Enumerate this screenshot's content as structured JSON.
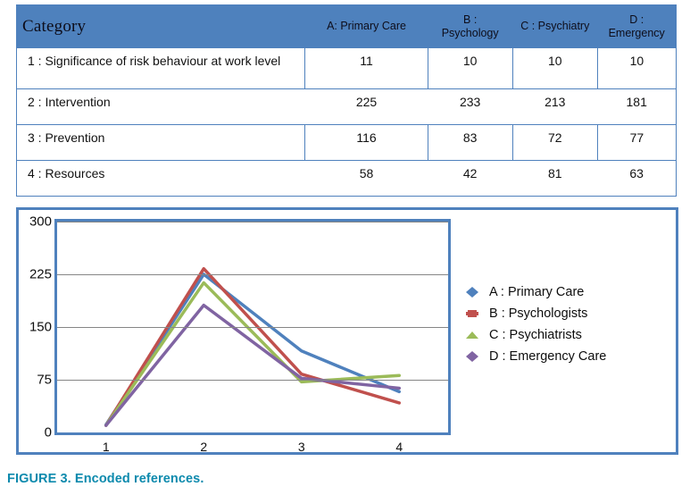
{
  "table": {
    "category_header": "Category",
    "column_headers": [
      "A: Primary Care",
      "B :\nPsychology",
      "C : Psychiatry",
      "D :\nEmergency"
    ],
    "column_headers_flat": [
      "A: Primary Care",
      "B : Psychology",
      "C : Psychiatry",
      "D : Emergency"
    ],
    "rows": [
      {
        "label": "1 : Significance of risk behaviour at work level",
        "values": [
          "11",
          "10",
          "10",
          "10"
        ]
      },
      {
        "label": "2 : Intervention",
        "values": [
          "225",
          "233",
          "213",
          "181"
        ]
      },
      {
        "label": "3 : Prevention",
        "values": [
          "116",
          "83",
          "72",
          "77"
        ]
      },
      {
        "label": "4 : Resources",
        "values": [
          "58",
          "42",
          "81",
          "63"
        ]
      }
    ],
    "header_bg": "#4e81bd",
    "border_color": "#4f81bd"
  },
  "chart_data": {
    "type": "line",
    "title": "",
    "xlabel": "",
    "ylabel": "",
    "categories": [
      "1",
      "2",
      "3",
      "4"
    ],
    "x_tick_labels": [
      "1",
      "2",
      "3",
      "4"
    ],
    "y_tick_labels": [
      "0",
      "75",
      "150",
      "225",
      "300"
    ],
    "y_ticks": [
      0,
      75,
      150,
      225,
      300
    ],
    "ylim": [
      0,
      300
    ],
    "grid": true,
    "legend_position": "right",
    "series": [
      {
        "name": "A : Primary Care",
        "values": [
          11,
          225,
          116,
          58
        ],
        "color": "#4f81bd",
        "marker": "diamond"
      },
      {
        "name": "B : Psychologists",
        "values": [
          10,
          233,
          83,
          42
        ],
        "color": "#c0504d",
        "marker": "square"
      },
      {
        "name": "C : Psychiatrists",
        "values": [
          10,
          213,
          72,
          81
        ],
        "color": "#9bbb59",
        "marker": "triangle"
      },
      {
        "name": "D : Emergency Care",
        "values": [
          10,
          181,
          77,
          63
        ],
        "color": "#8064a2",
        "marker": "diamond"
      }
    ]
  },
  "caption": {
    "text": "FIGURE 3. Encoded references.",
    "color": "#0d8aad"
  }
}
